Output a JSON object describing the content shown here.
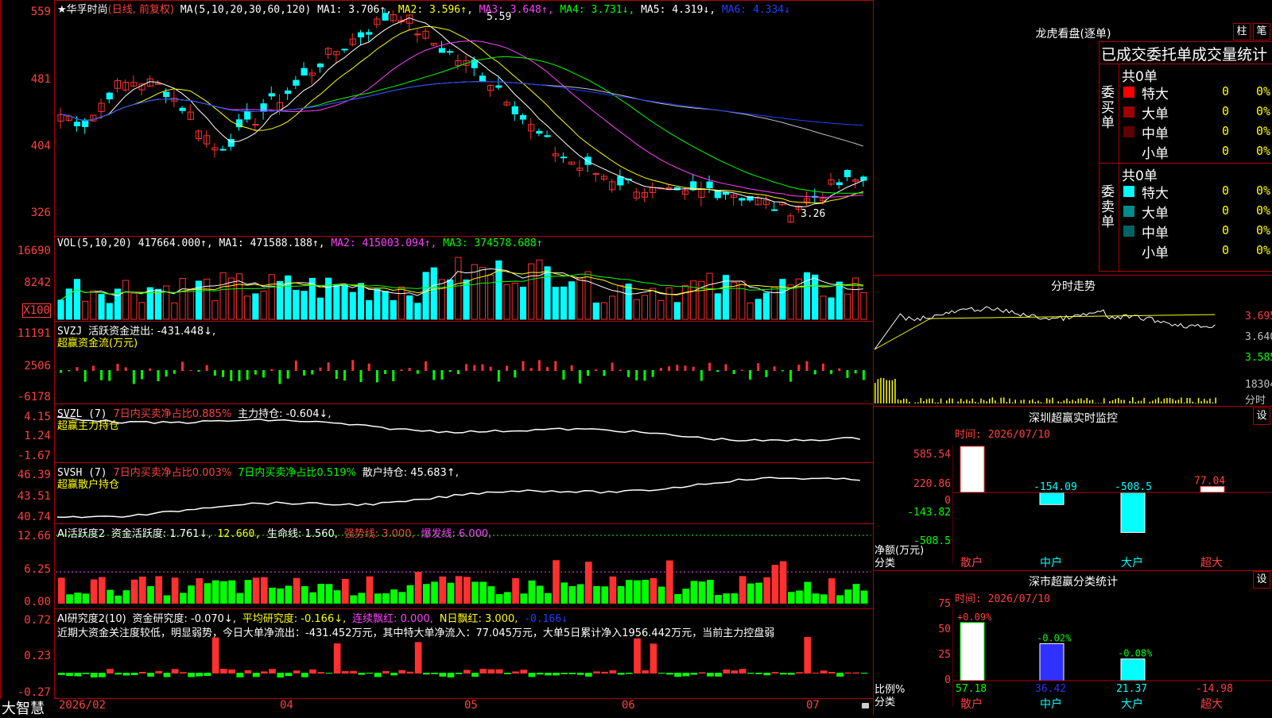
{
  "stock": {
    "name": "★华孚时尚",
    "period": "(日线, 前复权)",
    "ma_label": "MA(5,10,20,30,60,120)",
    "ma1": "MA1: 3.706↑,",
    "ma2": "MA2: 3.596↑,",
    "ma3": "MA3: 3.648↑,",
    "ma4": "MA4: 3.731↓,",
    "ma5": "MA5: 4.319↓,",
    "ma6": "MA6: 4.334↓",
    "high_mark": "5.59",
    "low_mark": "3.26",
    "y_labels": [
      "559",
      "481",
      "404",
      "326"
    ]
  },
  "vol": {
    "label": "VOL(5,10,20)",
    "value": "417664.000↑,",
    "ma1": "MA1: 471588.188↑,",
    "ma2": "MA2: 415003.094↑,",
    "ma3": "MA3: 374578.688↑",
    "y_labels": [
      "16690",
      "8242",
      "X100"
    ]
  },
  "svzj": {
    "label": "SVZJ",
    "desc": "活跃资金进出: -431.448↓,",
    "sub": "超赢资金流(万元)",
    "y_labels": [
      "11191",
      "2506",
      "-6178"
    ]
  },
  "svzl": {
    "label": "SVZL (7)",
    "desc1": "7日内买卖净占比0.885%",
    "desc2": "主力持仓: -0.604↓,",
    "sub": "超赢主力持仓",
    "y_labels": [
      "4.15",
      "1.24",
      "-1.67"
    ]
  },
  "svsh": {
    "label": "SVSH (7)",
    "desc1": "7日内买卖净占比0.003%",
    "desc2": "7日内买卖净占比0.519%",
    "desc3": "散户持仓: 45.683↑,",
    "sub": "超赢散户持仓",
    "y_labels": [
      "46.39",
      "43.51",
      "40.74"
    ]
  },
  "ai1": {
    "label": "AI活跃度2",
    "d1": "资金活跃度: 1.761↓,",
    "d2": "12.660,",
    "d3": "生命线: 1.560,",
    "d4": "强势线: 3.000,",
    "d5": "爆发线: 6.000,",
    "y_labels": [
      "12.66",
      "6.25",
      "0.00"
    ]
  },
  "ai2": {
    "label": "AI研究度2(10)",
    "d1": "资金研究度: -0.070↓,",
    "d2": "平均研究度: -0.166↓,",
    "d3": "连续飘红: 0.000,",
    "d4": "N日飘红: 3.000,",
    "d5": "-0.166↓",
    "comment": "近期大资金关注度较低，明显弱势，今日大单净流出：-431.452万元，其中特大单净流入：77.045万元，大单5日累计净入1956.442万元，当前主力控盘弱",
    "y_labels": [
      "0.72",
      "0.23",
      "-0.27"
    ]
  },
  "xaxis": {
    "brand": "大智慧",
    "labels": [
      "2026/02",
      "04",
      "05",
      "06",
      "07"
    ]
  },
  "longhu": {
    "title": "龙虎看盘(逐单)",
    "btn1": "柱",
    "btn2": "笔",
    "subtitle": "已成交委托单成交量统计",
    "buy": {
      "side": "委买单",
      "total": "共0单",
      "rows": [
        {
          "label": "特大",
          "count": "0",
          "pct": "0%",
          "color": "#ff0000"
        },
        {
          "label": "大单",
          "count": "0",
          "pct": "0%",
          "color": "#a00000"
        },
        {
          "label": "中单",
          "count": "0",
          "pct": "0%",
          "color": "#600000"
        },
        {
          "label": "小单",
          "count": "0",
          "pct": "0%",
          "color": ""
        }
      ]
    },
    "sell": {
      "side": "委卖单",
      "total": "共0单",
      "rows": [
        {
          "label": "特大",
          "count": "0",
          "pct": "0%",
          "color": "#00ffff"
        },
        {
          "label": "大单",
          "count": "0",
          "pct": "0%",
          "color": "#008c8c"
        },
        {
          "label": "中单",
          "count": "0",
          "pct": "0%",
          "color": "#006464"
        },
        {
          "label": "小单",
          "count": "0",
          "pct": "0%",
          "color": ""
        }
      ]
    }
  },
  "intraday": {
    "title": "分时走势",
    "y_labels": [
      "3.695",
      "3.640",
      "3.585"
    ],
    "vol_label": "18304",
    "vol_unit": "分时"
  },
  "monitor": {
    "title": "深圳超赢实时监控",
    "btn": "设",
    "time": "时间: 2026/07/10",
    "y_labels": [
      "585.54",
      "220.86",
      "0",
      "-143.82",
      "-508.5"
    ],
    "ylabel1": "净额(万元)",
    "ylabel2": "分类",
    "bar_labels": [
      "585.54",
      "-154.09",
      "-508.5",
      "77.04"
    ],
    "categories": [
      "散户",
      "中户",
      "大户",
      "超大"
    ]
  },
  "classify": {
    "title": "深市超赢分类统计",
    "btn": "设",
    "time": "时间: 2026/07/10",
    "y_labels": [
      "75",
      "50",
      "25",
      "0"
    ],
    "ylabel1": "比例%",
    "ylabel2": "分类",
    "top_labels": [
      "+0.09%",
      "-0.02%",
      "-0.08%"
    ],
    "bottom_values": [
      "57.18",
      "36.42",
      "21.37",
      "-14.98"
    ],
    "categories": [
      "散户",
      "中户",
      "大户",
      "超大"
    ]
  },
  "chart_data": {
    "type": "table",
    "monitor_net_amount": {
      "categories": [
        "散户",
        "中户",
        "大户",
        "超大"
      ],
      "values": [
        585.54,
        -154.09,
        -508.5,
        77.04
      ]
    },
    "classify_ratio": {
      "categories": [
        "散户",
        "中户",
        "大户",
        "超大"
      ],
      "values": [
        57.18,
        36.42,
        21.37,
        -14.98
      ]
    }
  },
  "colors": {
    "up": "#ff3030",
    "down": "#00ffff",
    "border": "#b00000",
    "bg": "#000000"
  }
}
